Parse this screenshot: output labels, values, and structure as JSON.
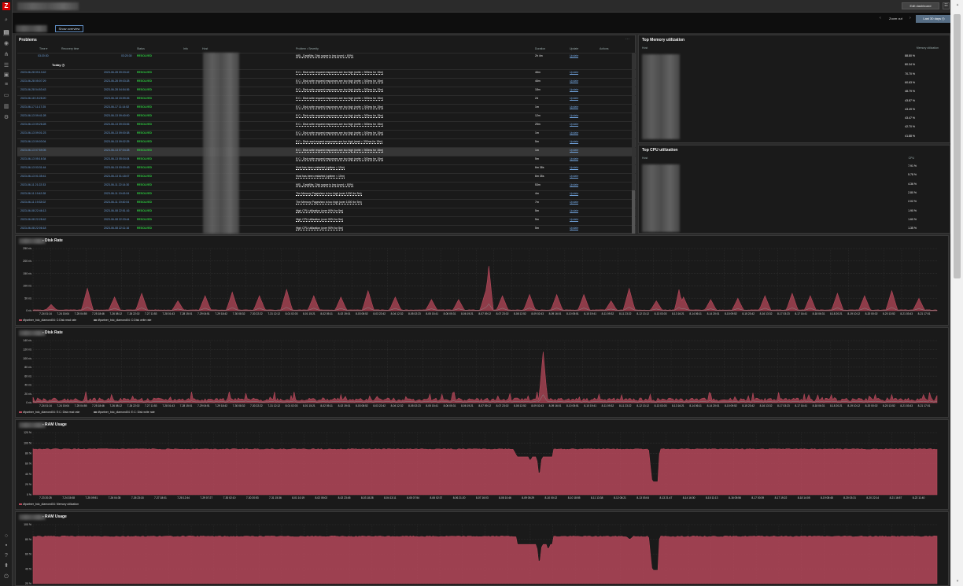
{
  "app": {
    "logo": "Z"
  },
  "sidebar": {
    "icons": [
      "search-icon",
      "dashboard-icon",
      "eye-icon",
      "network-icon",
      "list-icon",
      "report-icon",
      "layers-icon",
      "data-icon",
      "alert-icon",
      "gear-icon"
    ],
    "bottom_icons": [
      "support-icon",
      "share-icon",
      "help-icon",
      "user-icon",
      "power-icon"
    ]
  },
  "header": {
    "edit_label": "Edit dashboard"
  },
  "subheader": {
    "zoom_out": "Zoom out",
    "time_range": "Last 30 days",
    "show_overview": "Show overview"
  },
  "problems": {
    "title": "Problems",
    "columns": [
      "Time ▾",
      "Recovery time",
      "Status",
      "Info",
      "Host",
      "Problem • Severity",
      "Duration",
      "Update",
      "Actions"
    ],
    "first_row": {
      "time": "03:20:30",
      "recovery": "03:20:30",
      "status": "RESOLVED",
      "problem": "MSL_DataBits: Disk space is low (used > 80%)",
      "duration": "2h 4m",
      "update": "Update"
    },
    "today_label": "Today",
    "rows": [
      {
        "time": "2023-06-28 09:13:42",
        "recovery": "2023-06-28 09:03:42",
        "status": "RESOLVED",
        "problem": "E:C:: Disk write request responses are too high (write > 300ms for 15m)",
        "duration": "46m",
        "update": "Update"
      },
      {
        "time": "2023-06-28 05:07:29",
        "recovery": "2023-06-28 09:03:28",
        "status": "RESOLVED",
        "problem": "E:C:: Disk write request responses are too high (write > 300ms for 15m)",
        "duration": "46m",
        "update": "Update"
      },
      {
        "time": "2023-06-28 04:53:43",
        "recovery": "2023-06-28 04:54:36",
        "status": "RESOLVED",
        "problem": "E:C:: Disk write request responses are too high (write > 300ms for 15m)",
        "duration": "18m",
        "update": "Update"
      },
      {
        "time": "2023-06-18 15:28:20",
        "recovery": "2023-06-18 15:59:26",
        "status": "RESOLVED",
        "problem": "E:C:: Disk write request responses are too high (write > 300ms for 15m)",
        "duration": "2d",
        "update": "Update"
      },
      {
        "time": "2023-06-17 11:17:25",
        "recovery": "2023-06-17 11:14:52",
        "status": "RESOLVED",
        "problem": "E:C:: Disk write request responses are too high (write > 300ms for 15m)",
        "duration": "1m",
        "update": "Update"
      },
      {
        "time": "2023-06-13 09:41:28",
        "recovery": "2023-06-13 09:40:00",
        "status": "RESOLVED",
        "problem": "E:C:: Disk write request responses are too high (write > 300ms for 15m)",
        "duration": "12m",
        "update": "Update"
      },
      {
        "time": "2023-06-13 09:26:28",
        "recovery": "2023-06-13 09:03:06",
        "status": "RESOLVED",
        "problem": "E:C:: Disk write request responses are too high (write > 300ms for 15m)",
        "duration": "25m",
        "update": "Update"
      },
      {
        "time": "2023-06-13 09:01:23",
        "recovery": "2023-06-13 09:00:38",
        "status": "RESOLVED",
        "problem": "E:C:: Disk write request responses are too high (write > 300ms for 15m)",
        "duration": "1m",
        "update": "Update"
      },
      {
        "time": "2023-06-13 09:03:04",
        "recovery": "2023-06-13 09:02:25",
        "status": "RESOLVED",
        "problem": "E:C:: Disk read request responses are too high (read > 300ms for 15m)",
        "duration": "5m",
        "update": "Update"
      },
      {
        "time": "2023-06-13 07:59:05",
        "recovery": "2023-06-13 07:04:28",
        "status": "RESOLVED",
        "problem": "E:C:: Disk write request responses are too high (write > 300ms for 15m)",
        "duration": "1m",
        "update": "Update"
      },
      {
        "time": "2023-06-13 05:16:34",
        "recovery": "2023-06-13 05:04:04",
        "status": "RESOLVED",
        "problem": "E:C:: Disk write request responses are too high (write > 300ms for 15m)",
        "duration": "5m",
        "update": "Update"
      },
      {
        "time": "2023-06-13 03:31:44",
        "recovery": "2023-06-13 03:00:43",
        "status": "RESOLVED",
        "problem": "Host has been restarted (uptime < 10m)",
        "duration": "6m 38s",
        "update": "Update"
      },
      {
        "time": "2023-06-13 01:35:41",
        "recovery": "2023-06-13 01:18:07",
        "status": "RESOLVED",
        "problem": "Host has been restarted (uptime < 10m)",
        "duration": "6m 35s",
        "update": "Update"
      },
      {
        "time": "2023-06-11 21:22:33",
        "recovery": "2023-06-11 22:14:30",
        "status": "RESOLVED",
        "problem": "MSL_DataBits: Disk space is low (used > 80%)",
        "duration": "53m",
        "update": "Update"
      },
      {
        "time": "2023-06-11 19:42:28",
        "recovery": "2023-06-11 19:43:04",
        "status": "RESOLVED",
        "problem": "The Memory Pages/sec is too high (over 1000 for 5m)",
        "duration": "4m",
        "update": "Update"
      },
      {
        "time": "2023-06-11 19:33:02",
        "recovery": "2023-06-11 19:40:04",
        "status": "RESOLVED",
        "problem": "The Memory Pages/sec is too high (over 1000 for 5m)",
        "duration": "7m",
        "update": "Update"
      },
      {
        "time": "2023-06-08 22:46:13",
        "recovery": "2023-06-08 22:51:16",
        "status": "RESOLVED",
        "problem": "High CPU utilization (over 90% for 5m)",
        "duration": "5m",
        "update": "Update"
      },
      {
        "time": "2023-06-08 22:28:42",
        "recovery": "2023-06-08 22:33:44",
        "status": "RESOLVED",
        "problem": "High CPU utilization (over 90% for 5m)",
        "duration": "5m",
        "update": "Update"
      },
      {
        "time": "2023-06-08 22:06:18",
        "recovery": "2023-06-08 22:11:16",
        "status": "RESOLVED",
        "problem": "High CPU utilization (over 90% for 5m)",
        "duration": "5m",
        "update": "Update"
      },
      {
        "time": "2023-06-08 22:47:53",
        "recovery": "2023-06-08 22:47:07",
        "status": "RESOLVED",
        "problem": "Host has been restarted (uptime < 10m)",
        "duration": "6m 49s",
        "update": "Update"
      }
    ]
  },
  "top_memory": {
    "title": "Top Memory utilization",
    "col_host": "Host",
    "col_value": "Memory utilization",
    "values": [
      "88.80 %",
      "80.34 %",
      "70.70 %",
      "60.63 %",
      "48.79 %",
      "43.87 %",
      "43.49 %",
      "43.47 %",
      "42.70 %",
      "41.88 %"
    ]
  },
  "top_cpu": {
    "title": "Top CPU utilization",
    "col_host": "Host",
    "col_value": "CPU",
    "values": [
      "7.91 %",
      "5.78 %",
      "4.36 %",
      "2.80 %",
      "2.02 %",
      "1.90 %",
      "1.60 %",
      "1.35 %"
    ]
  },
  "colors": {
    "series_red": "#b5485a",
    "series_gray": "#8d8d8d",
    "resolved": "#2ecc40",
    "link": "#6fa0d8",
    "accent": "#566d84"
  },
  "chart_data": [
    {
      "type": "area",
      "title": "- Disk Rate",
      "y_ticks": [
        "250 r/s",
        "200 r/s",
        "150 r/s",
        "100 r/s",
        "50 r/s",
        "0 r/s"
      ],
      "ylim": [
        0,
        250
      ],
      "x_ticks": [
        "7-24 01:14",
        "7-24 15:04",
        "7-25 04:55",
        "7-25 18:46",
        "7-26 08:12",
        "7-26 22:02",
        "7-27 11:53",
        "7-28 01:43",
        "7-28 15:01",
        "7-29 04:51",
        "7-29 18:42",
        "7-30 08:32",
        "7-30 22:22",
        "7-31 12:12",
        "8-01 02:03",
        "8-01 15:21",
        "8-02 05:11",
        "8-02 19:01",
        "8-03 08:52",
        "8-03 22:42",
        "8-04 12:32",
        "8-05 02:23",
        "8-05 15:41",
        "8-06 05:31",
        "8-06 19:21",
        "8-07 09:12",
        "8-07 23:02",
        "8-08 12:52",
        "8-09 02:43",
        "8-09 16:01",
        "8-10 05:51",
        "8-10 19:41",
        "8-11 09:32",
        "8-11 23:22",
        "8-12 13:12",
        "8-13 03:03",
        "8-13 16:21",
        "8-14 06:11",
        "8-14 20:01",
        "8-15 09:52",
        "8-15 23:42",
        "8-16 13:32",
        "8-17 03:23",
        "8-17 16:41",
        "8-18 06:31",
        "8-18 20:21",
        "8-19 10:12",
        "8-20 00:02",
        "8-20 13:52",
        "8-21 03:43",
        "8-21 17:01"
      ],
      "baseline": 2,
      "spikes": [
        [
          0.02,
          25
        ],
        [
          0.06,
          90
        ],
        [
          0.09,
          55
        ],
        [
          0.12,
          70
        ],
        [
          0.16,
          40
        ],
        [
          0.19,
          60
        ],
        [
          0.22,
          75
        ],
        [
          0.25,
          60
        ],
        [
          0.28,
          85
        ],
        [
          0.31,
          60
        ],
        [
          0.34,
          55
        ],
        [
          0.37,
          80
        ],
        [
          0.4,
          55
        ],
        [
          0.44,
          45
        ],
        [
          0.47,
          45
        ],
        [
          0.5,
          80
        ],
        [
          0.52,
          60
        ],
        [
          0.55,
          65
        ],
        [
          0.58,
          65
        ],
        [
          0.61,
          65
        ],
        [
          0.64,
          40
        ],
        [
          0.66,
          90
        ],
        [
          0.69,
          40
        ],
        [
          0.72,
          55
        ],
        [
          0.75,
          45
        ],
        [
          0.78,
          50
        ],
        [
          0.81,
          60
        ],
        [
          0.84,
          70
        ],
        [
          0.86,
          60
        ],
        [
          0.89,
          70
        ],
        [
          0.92,
          60
        ],
        [
          0.95,
          80
        ],
        [
          0.98,
          50
        ]
      ],
      "big_spikes": [
        [
          0.505,
          180
        ],
        [
          0.715,
          85
        ]
      ],
      "series": [
        {
          "name": "dfpartner_bdc_diamond04: C:Disk read rate",
          "color": "#b5485a"
        },
        {
          "name": "dfpartner_bdc_diamond04: C:Disk write rate",
          "color": "#8d8d8d"
        }
      ]
    },
    {
      "type": "area",
      "title": "- Disk Rate",
      "y_ticks": [
        "140 r/s",
        "120 r/s",
        "100 r/s",
        "80 r/s",
        "60 r/s",
        "40 r/s",
        "20 r/s",
        "0 r/s"
      ],
      "ylim": [
        0,
        140
      ],
      "x_ticks": [
        "7-24 01:14",
        "7-24 15:04",
        "7-25 04:55",
        "7-25 18:46",
        "7-26 08:12",
        "7-26 22:02",
        "7-27 11:53",
        "7-28 01:43",
        "7-28 15:01",
        "7-29 04:51",
        "7-29 18:42",
        "7-30 08:32",
        "7-30 22:22",
        "7-31 12:12",
        "8-01 02:03",
        "8-01 15:21",
        "8-02 05:11",
        "8-02 19:01",
        "8-03 08:52",
        "8-03 22:42",
        "8-04 12:32",
        "8-05 02:23",
        "8-05 15:41",
        "8-06 05:31",
        "8-06 19:21",
        "8-07 09:12",
        "8-07 23:02",
        "8-08 12:52",
        "8-09 02:43",
        "8-09 16:01",
        "8-10 05:51",
        "8-10 19:41",
        "8-11 09:32",
        "8-11 23:22",
        "8-12 13:12",
        "8-13 03:03",
        "8-13 16:21",
        "8-14 06:11",
        "8-14 20:01",
        "8-15 09:52",
        "8-15 23:42",
        "8-16 13:32",
        "8-17 03:23",
        "8-17 16:41",
        "8-18 06:31",
        "8-18 20:21",
        "8-19 10:12",
        "8-20 00:02",
        "8-20 13:52",
        "8-21 03:43",
        "8-21 17:01"
      ],
      "baseline": 3,
      "noise_amp": 22,
      "big_spikes": [
        [
          0.565,
          115
        ]
      ],
      "series": [
        {
          "name": "dfpartner_bdc_diamond04: E:C: Disk read rate",
          "color": "#b5485a"
        },
        {
          "name": "dfpartner_bdc_diamond04: E:C: Disk write rate",
          "color": "#8d8d8d"
        }
      ]
    },
    {
      "type": "area",
      "title": "- RAM Usage",
      "y_ticks": [
        "120 %",
        "100 %",
        "80 %",
        "60 %",
        "40 %",
        "20 %",
        "0 %"
      ],
      "ylim": [
        0,
        120
      ],
      "x_ticks": [
        "7-23 20:25",
        "7-24 15:08",
        "7-25 09:51",
        "7-26 04:35",
        "7-26 23:18",
        "7-27 18:01",
        "7-28 12:44",
        "7-29 07:27",
        "7-30 02:10",
        "7-30 20:53",
        "7-31 15:36",
        "8-01 10:19",
        "8-02 05:02",
        "8-02 23:45",
        "8-03 18:28",
        "8-04 13:11",
        "8-05 07:54",
        "8-06 02:37",
        "8-06 21:20",
        "8-07 16:03",
        "8-08 10:46",
        "8-09 05:29",
        "8-10 00:12",
        "8-10 18:55",
        "8-11 13:38",
        "8-12 08:21",
        "8-13 03:04",
        "8-13 21:47",
        "8-14 16:30",
        "8-15 11:13",
        "8-16 05:56",
        "8-17 00:39",
        "8-17 19:22",
        "8-18 14:05",
        "8-19 08:48",
        "8-20 03:31",
        "8-20 22:14",
        "8-21 16:57",
        "8-22 11:40"
      ],
      "level": 88,
      "dips": [
        [
          0.535,
          75
        ],
        [
          0.55,
          62
        ],
        [
          0.56,
          30
        ],
        [
          0.57,
          80
        ],
        [
          0.685,
          20
        ],
        [
          0.69,
          55
        ]
      ],
      "series": [
        {
          "name": "dfpartner_bdc_diamond04: Memory utilization",
          "color": "#b5485a"
        }
      ]
    },
    {
      "type": "area",
      "title": "- RAM Usage",
      "y_ticks": [
        "100 %",
        "80 %",
        "60 %",
        "40 %",
        "20 %"
      ],
      "ylim": [
        0,
        110
      ],
      "x_ticks": [],
      "level": 88,
      "dips": [
        [
          0.55,
          70
        ],
        [
          0.56,
          30
        ],
        [
          0.57,
          60
        ],
        [
          0.66,
          82
        ],
        [
          0.685,
          20
        ],
        [
          0.69,
          70
        ]
      ],
      "series": []
    }
  ]
}
